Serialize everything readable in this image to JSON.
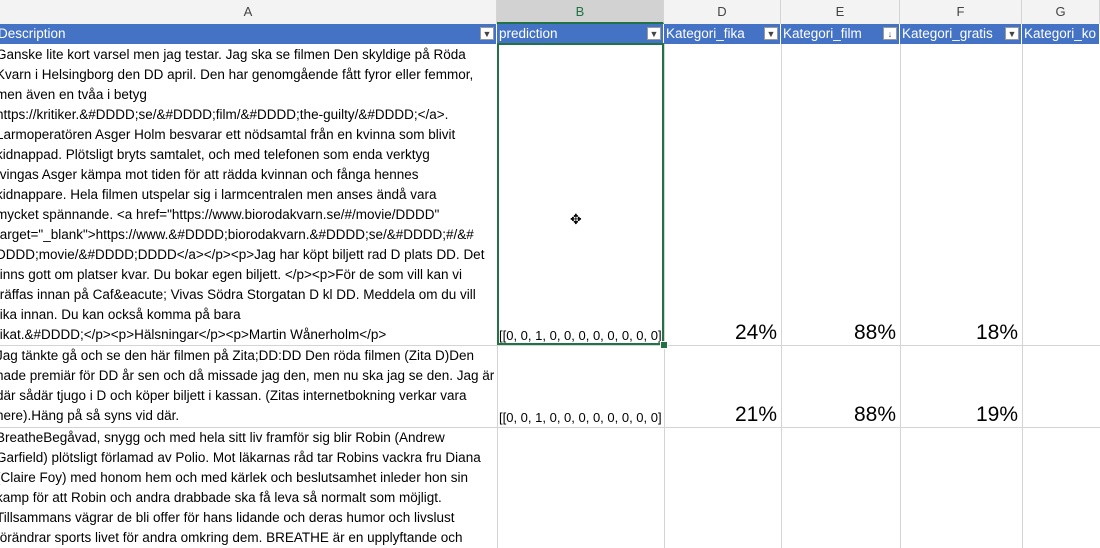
{
  "column_letters": [
    "A",
    "B",
    "D",
    "E",
    "F",
    "G"
  ],
  "headers": {
    "a": "Description",
    "b": "prediction",
    "d": "Kategori_fika",
    "e": "Kategori_film",
    "f": "Kategori_gratis",
    "g": "Kategori_ko"
  },
  "rows": [
    {
      "description": "Ganske lite kort varsel men jag testar. Jag ska se filmen Den skyldige på Röda\nKvarn i Helsingborg den DD april. Den har genomgående fått fyror eller femmor,\nmen även en tvåa i betyg\nhttps://kritiker.&#DDDD;se/&#DDDD;film/&#DDDD;the-guilty/&#DDDD;</a>.\nLarmoperatören Asger Holm besvarar ett nödsamtal från en kvinna som blivit\nkidnappad. Plötsligt bryts samtalet, och med telefonen som enda verktyg\ntvingas Asger kämpa mot tiden för att rädda kvinnan och fånga hennes\nkidnappare. Hela filmen utspelar sig i larmcentralen men anses ändå vara\nmycket spännande. <a href=\"https://www.biorodakvarn.se/#/movie/DDDD\"\ntarget=\"_blank\">https://www.&#DDDD;biorodakvarn.&#DDDD;se/&#DDDD;#/&#\nDDDD;movie/&#DDDD;DDDD</a></p><p>Jag har köpt biljett rad D plats DD. Det\nfinns gott om platser kvar. Du bokar egen biljett. </p><p>För de som vill kan vi\nträffas innan på Caf&eacute; Vivas Södra Storgatan D kl DD. Meddela om du vill\nfika innan. Du kan också komma på bara\nfikat.&#DDDD;</p><p>Hälsningar</p><p>Martin Wånerholm</p>",
      "prediction": "[[0, 0, 1, 0, 0, 0, 0, 0, 0, 0, 0]",
      "fika": "24%",
      "film": "88%",
      "gratis": "18%"
    },
    {
      "description": "Jag tänkte gå och se den här filmen på Zita;DD:DD Den röda filmen (Zita D)Den\nhade premiär för DD år sen och då missade jag den, men nu ska jag se den. Jag är\ndär sådär tjugo i D och köper biljett i kassan. (Zitas internetbokning verkar vara\nnere).Häng på så syns vid där.",
      "prediction": "[[0, 0, 1, 0, 0, 0, 0, 0, 0, 0, 0]",
      "fika": "21%",
      "film": "88%",
      "gratis": "19%"
    },
    {
      "description": "BreatheBegåvad, snygg och med hela sitt liv framför sig blir Robin (Andrew\nGarfield) plötsligt förlamad av Polio. Mot läkarnas råd tar Robins vackra fru Diana\n(Claire Foy) med honom hem och med kärlek och beslutsamhet inleder hon sin\nkamp för att Robin och andra drabbade ska få leva så normalt som möjligt.\nTillsammans vägrar de bli offer för hans lidande och deras humor och livslust\nförändrar sports livet för andra omkring dem. BREATHE är en upplyftande och",
      "prediction": "",
      "fika": "",
      "film": "",
      "gratis": ""
    }
  ],
  "colors": {
    "header_bg": "#4472c4",
    "selection": "#217346"
  }
}
